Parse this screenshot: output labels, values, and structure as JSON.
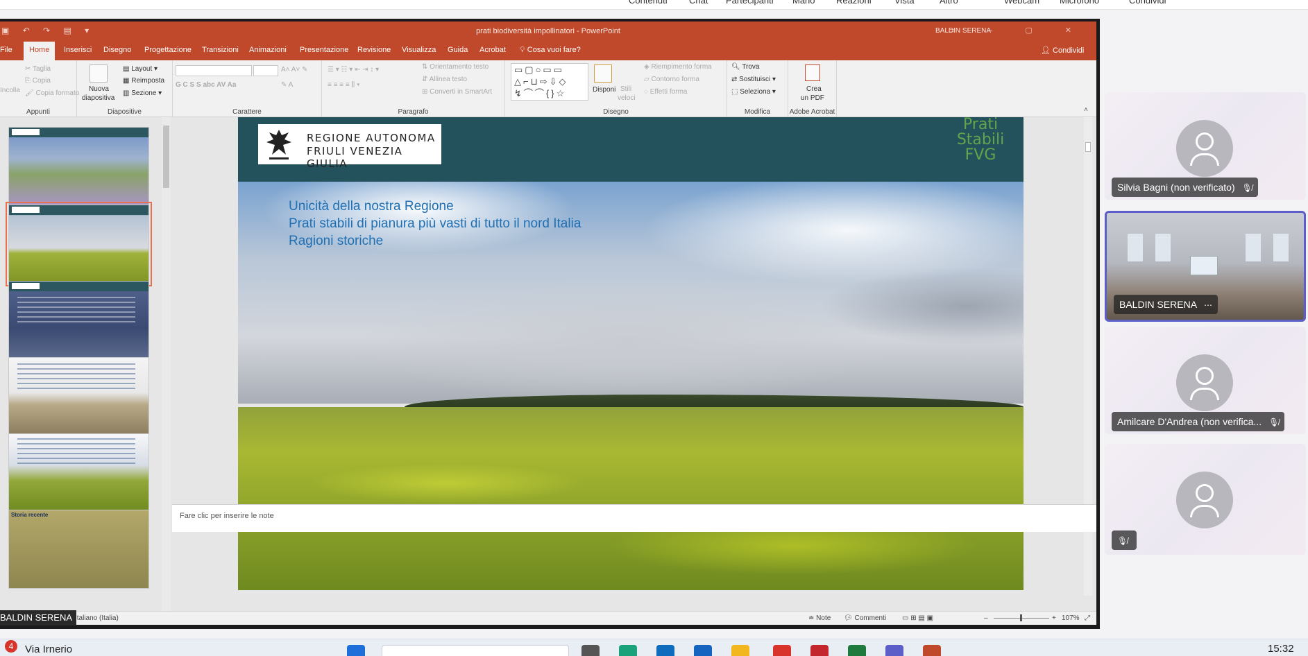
{
  "teams_bar": {
    "items": [
      "Contenuti",
      "Chat",
      "Partecipanti",
      "Mano",
      "Reazioni",
      "Vista",
      "Altro",
      "Webcam",
      "Microfono",
      "Condividi"
    ]
  },
  "ppt": {
    "doc_title": "prati biodiversità impollinatori  -  PowerPoint",
    "user": "BALDIN SERENA",
    "tabs": [
      "File",
      "Home",
      "Inserisci",
      "Disegno",
      "Progettazione",
      "Transizioni",
      "Animazioni",
      "Presentazione",
      "Revisione",
      "Visualizza",
      "Guida",
      "Acrobat"
    ],
    "tell_me": "Cosa vuoi fare?",
    "share": "Condividi",
    "ribbon": {
      "clipboard": {
        "label": "Appunti",
        "cut": "Taglia",
        "copy": "Copia",
        "format_painter": "Copia formato",
        "paste": "Incolla"
      },
      "slides": {
        "label": "Diapositive",
        "new_slide_1": "Nuova",
        "new_slide_2": "diapositiva",
        "layout": "Layout",
        "reset": "Reimposta",
        "section": "Sezione"
      },
      "font": {
        "label": "Carattere"
      },
      "paragraph": {
        "label": "Paragrafo",
        "text_direction": "Orientamento testo",
        "align_text": "Allinea testo",
        "smartart": "Converti in SmartArt"
      },
      "drawing": {
        "label": "Disegno",
        "arrange": "Disponi",
        "quick_styles_1": "Stili",
        "quick_styles_2": "veloci",
        "shape_fill": "Riempimento forma",
        "shape_outline": "Contorno forma",
        "shape_effects": "Effetti forma"
      },
      "editing": {
        "label": "Modifica",
        "find": "Trova",
        "replace": "Sostituisci",
        "select": "Seleziona"
      },
      "acrobat": {
        "label": "Adobe Acrobat",
        "create_pdf_1": "Crea",
        "create_pdf_2": "un PDF"
      }
    },
    "slide": {
      "logo_line1": "REGIONE AUTONOMA",
      "logo_line2": "FRIULI VENEZIA GIULIA",
      "brand_line1": "Prati",
      "brand_line2": "Stabili",
      "brand_line3": "FVG",
      "bullets": [
        "Unicità della nostra Regione",
        "Prati stabili di pianura più vasti di tutto il nord Italia",
        "Ragioni storiche"
      ]
    },
    "thumbnails": {
      "thumb6_title": "Storia recente"
    },
    "notes_placeholder": "Fare clic per inserire le note",
    "statusbar": {
      "language": "Italiano (Italia)",
      "notes": "Note",
      "comments": "Commenti",
      "zoom": "107%"
    }
  },
  "speaker_tag": "BALDIN SERENA",
  "participants": [
    {
      "name": "Silvia Bagni (non verificato)",
      "muted": true
    },
    {
      "name": "BALDIN SERENA",
      "muted": false,
      "video": true
    },
    {
      "name": "Amilcare D'Andrea (non verifica...",
      "muted": true
    },
    {
      "name": "",
      "muted": true
    }
  ],
  "taskbar": {
    "notification_count": "4",
    "weather_text": "Via Irnerio",
    "clock": "15:32"
  }
}
